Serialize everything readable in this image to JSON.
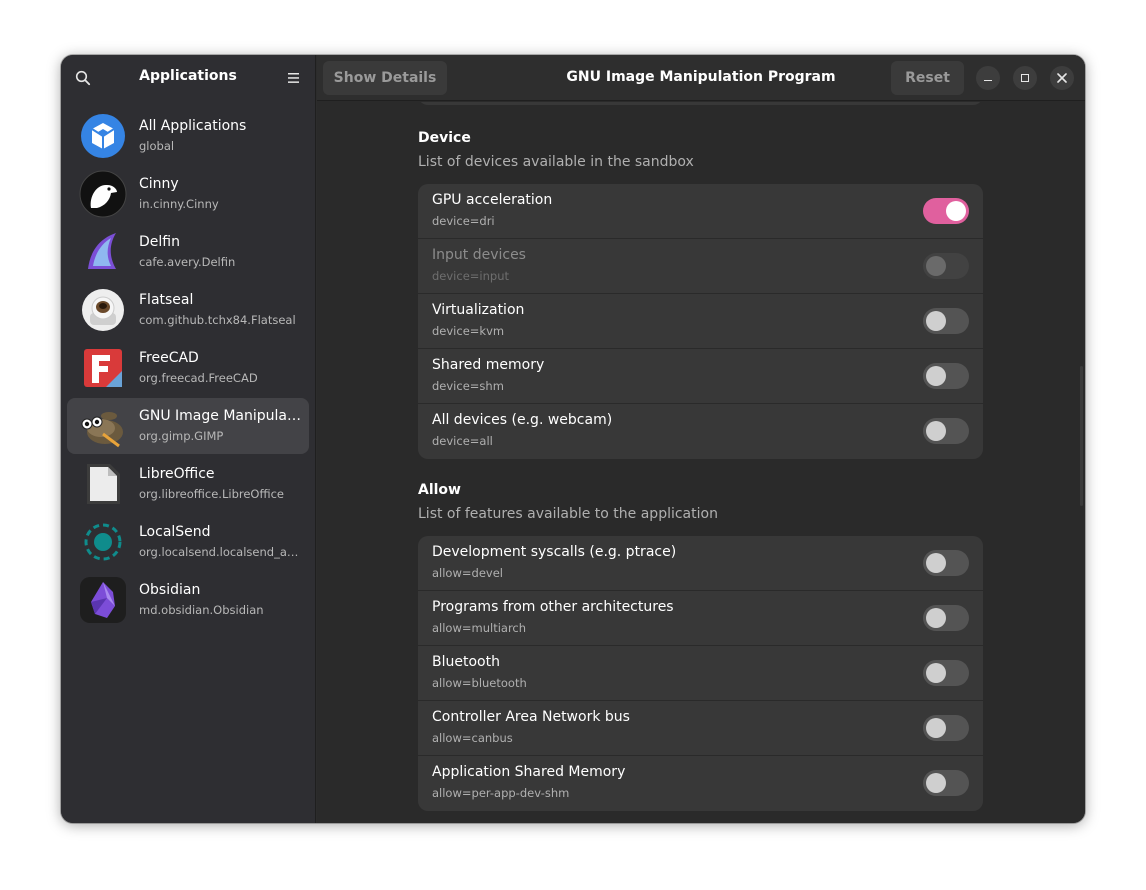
{
  "sidebar": {
    "title": "Applications",
    "search_icon": "search-icon",
    "menu_icon": "hamburger-menu-icon",
    "apps": [
      {
        "name": "All Applications",
        "id": "global",
        "icon": "all-applications-icon"
      },
      {
        "name": "Cinny",
        "id": "in.cinny.Cinny",
        "icon": "cinny-icon"
      },
      {
        "name": "Delfin",
        "id": "cafe.avery.Delfin",
        "icon": "delfin-icon"
      },
      {
        "name": "Flatseal",
        "id": "com.github.tchx84.Flatseal",
        "icon": "flatseal-icon"
      },
      {
        "name": "FreeCAD",
        "id": "org.freecad.FreeCAD",
        "icon": "freecad-icon"
      },
      {
        "name": "GNU Image Manipulation Program",
        "id": "org.gimp.GIMP",
        "icon": "gimp-icon",
        "selected": true
      },
      {
        "name": "LibreOffice",
        "id": "org.libreoffice.LibreOffice",
        "icon": "libreoffice-icon"
      },
      {
        "name": "LocalSend",
        "id": "org.localsend.localsend_app",
        "icon": "localsend-icon"
      },
      {
        "name": "Obsidian",
        "id": "md.obsidian.Obsidian",
        "icon": "obsidian-icon"
      }
    ]
  },
  "header": {
    "show_details": "Show Details",
    "title": "GNU Image Manipulation Program",
    "reset": "Reset"
  },
  "device": {
    "title": "Device",
    "subtitle": "List of devices available in the sandbox",
    "rows": [
      {
        "title": "GPU acceleration",
        "sub": "device=dri",
        "on": true,
        "disabled": false
      },
      {
        "title": "Input devices",
        "sub": "device=input",
        "on": false,
        "disabled": true
      },
      {
        "title": "Virtualization",
        "sub": "device=kvm",
        "on": false,
        "disabled": false
      },
      {
        "title": "Shared memory",
        "sub": "device=shm",
        "on": false,
        "disabled": false
      },
      {
        "title": "All devices (e.g. webcam)",
        "sub": "device=all",
        "on": false,
        "disabled": false
      }
    ]
  },
  "allow": {
    "title": "Allow",
    "subtitle": "List of features available to the application",
    "rows": [
      {
        "title": "Development syscalls (e.g. ptrace)",
        "sub": "allow=devel",
        "on": false
      },
      {
        "title": "Programs from other architectures",
        "sub": "allow=multiarch",
        "on": false
      },
      {
        "title": "Bluetooth",
        "sub": "allow=bluetooth",
        "on": false
      },
      {
        "title": "Controller Area Network bus",
        "sub": "allow=canbus",
        "on": false
      },
      {
        "title": "Application Shared Memory",
        "sub": "allow=per-app-dev-shm",
        "on": false
      }
    ]
  },
  "colors": {
    "accent": "#e0609e",
    "window_bg": "#2a2a2a",
    "sidebar_bg": "#2e2e32",
    "card_bg": "#383838"
  }
}
